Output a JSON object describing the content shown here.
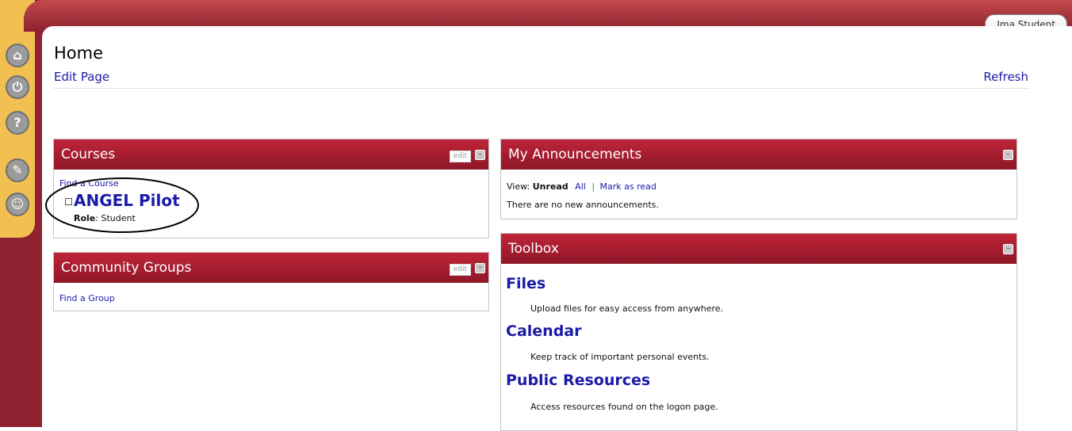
{
  "header": {
    "title": "Home",
    "edit_page": "Edit Page",
    "refresh": "Refresh",
    "user": "Ima Student"
  },
  "nav_icons": [
    "home-icon",
    "power-icon",
    "help-icon",
    "wrench-icon",
    "chat-icon"
  ],
  "courses": {
    "title": "Courses",
    "edit": "edit",
    "find_course": "Find a Course",
    "course_name": "ANGEL Pilot",
    "role_label": "Role",
    "role_value": ": Student"
  },
  "community": {
    "title": "Community Groups",
    "edit": "edit",
    "find_group": "Find a Group"
  },
  "announcements": {
    "title": "My Announcements",
    "view_label": "View: ",
    "unread": "Unread",
    "all": "All",
    "separator": "|",
    "mark_read": "Mark as read",
    "empty": "There are no new announcements."
  },
  "toolbox": {
    "title": "Toolbox",
    "items": [
      {
        "name": "Files",
        "desc": "Upload files for easy access from anywhere."
      },
      {
        "name": "Calendar",
        "desc": "Keep track of important personal events."
      },
      {
        "name": "Public Resources",
        "desc": "Access resources found on the logon page."
      }
    ]
  }
}
